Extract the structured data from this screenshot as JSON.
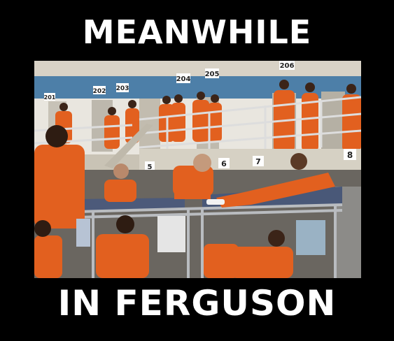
{
  "meme": {
    "top_text": "MEANWHILE",
    "bottom_text": "IN FERGUSON"
  },
  "photo": {
    "upper_cell_numbers": [
      "202",
      "203",
      "204",
      "205",
      "206"
    ],
    "lower_cell_numbers": [
      "5",
      "6",
      "7",
      "8"
    ],
    "far_left_cell_number": "201"
  },
  "colors": {
    "background": "#000000",
    "caption_text": "#ffffff",
    "jumpsuit": "#e2601f",
    "railing": "#dddddd",
    "wall_blue": "#4d7fa8"
  }
}
